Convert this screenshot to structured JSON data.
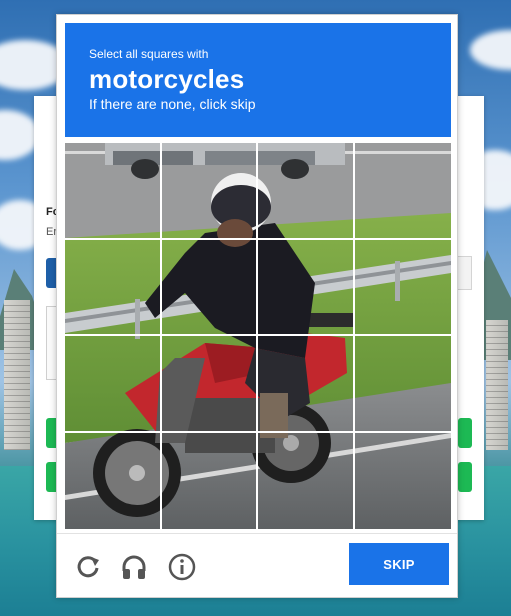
{
  "background": {
    "form": {
      "label": "Fo",
      "sub": "Er"
    }
  },
  "captcha": {
    "instruction": "Select all squares with",
    "target": "motorcycles",
    "hint": "If there are none, click skip",
    "grid": {
      "rows": 4,
      "cols": 4
    },
    "footer": {
      "reload_icon": "reload-icon",
      "audio_icon": "headphones-icon",
      "info_icon": "info-icon",
      "skip_label": "SKIP"
    },
    "colors": {
      "accent": "#1a73e8",
      "icon": "#555555"
    }
  }
}
